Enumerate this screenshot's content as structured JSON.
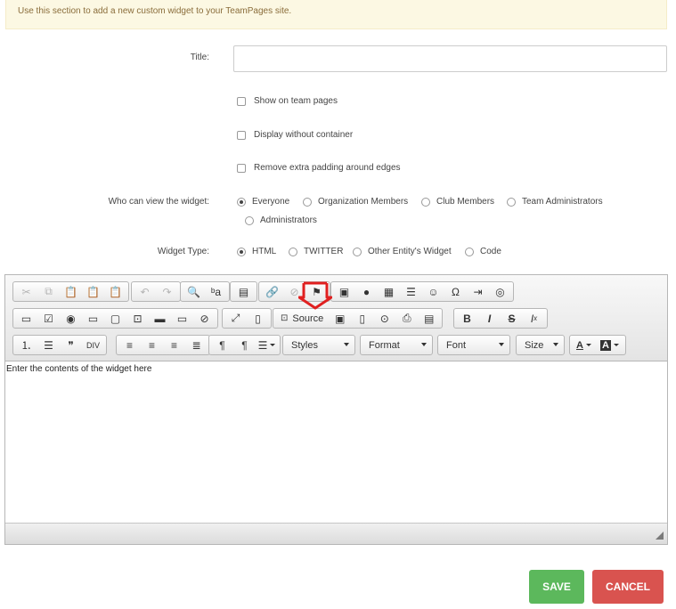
{
  "notice": "Use this section to add a new custom widget to your TeamPages site.",
  "form": {
    "title_label": "Title:",
    "title_value": "",
    "checkboxes": [
      {
        "label": "Show on team pages",
        "checked": false
      },
      {
        "label": "Display without container",
        "checked": false
      },
      {
        "label": "Remove extra padding around edges",
        "checked": false
      }
    ],
    "view_label": "Who can view the widget:",
    "view_options": [
      {
        "label": "Everyone",
        "selected": true
      },
      {
        "label": "Organization Members",
        "selected": false
      },
      {
        "label": "Club Members",
        "selected": false
      },
      {
        "label": "Team Administrators",
        "selected": false
      },
      {
        "label": "Administrators",
        "selected": false
      }
    ],
    "type_label": "Widget Type:",
    "type_options": [
      {
        "label": "HTML",
        "selected": true
      },
      {
        "label": "TWITTER",
        "selected": false
      },
      {
        "label": "Other Entity's Widget",
        "selected": false
      },
      {
        "label": "Code",
        "selected": false
      }
    ]
  },
  "editor": {
    "source_label": "Source",
    "styles_label": "Styles",
    "format_label": "Format",
    "font_label": "Font",
    "size_label": "Size",
    "text_color_label": "A",
    "bg_color_label": "A",
    "div_label": "DIV",
    "content": "Enter the contents of the widget here",
    "highlight_color": "#e02020"
  },
  "buttons": {
    "save": "SAVE",
    "cancel": "CANCEL"
  },
  "colors": {
    "save": "#5cb85c",
    "cancel": "#d9534f",
    "notice_bg": "#fcf8e3"
  }
}
